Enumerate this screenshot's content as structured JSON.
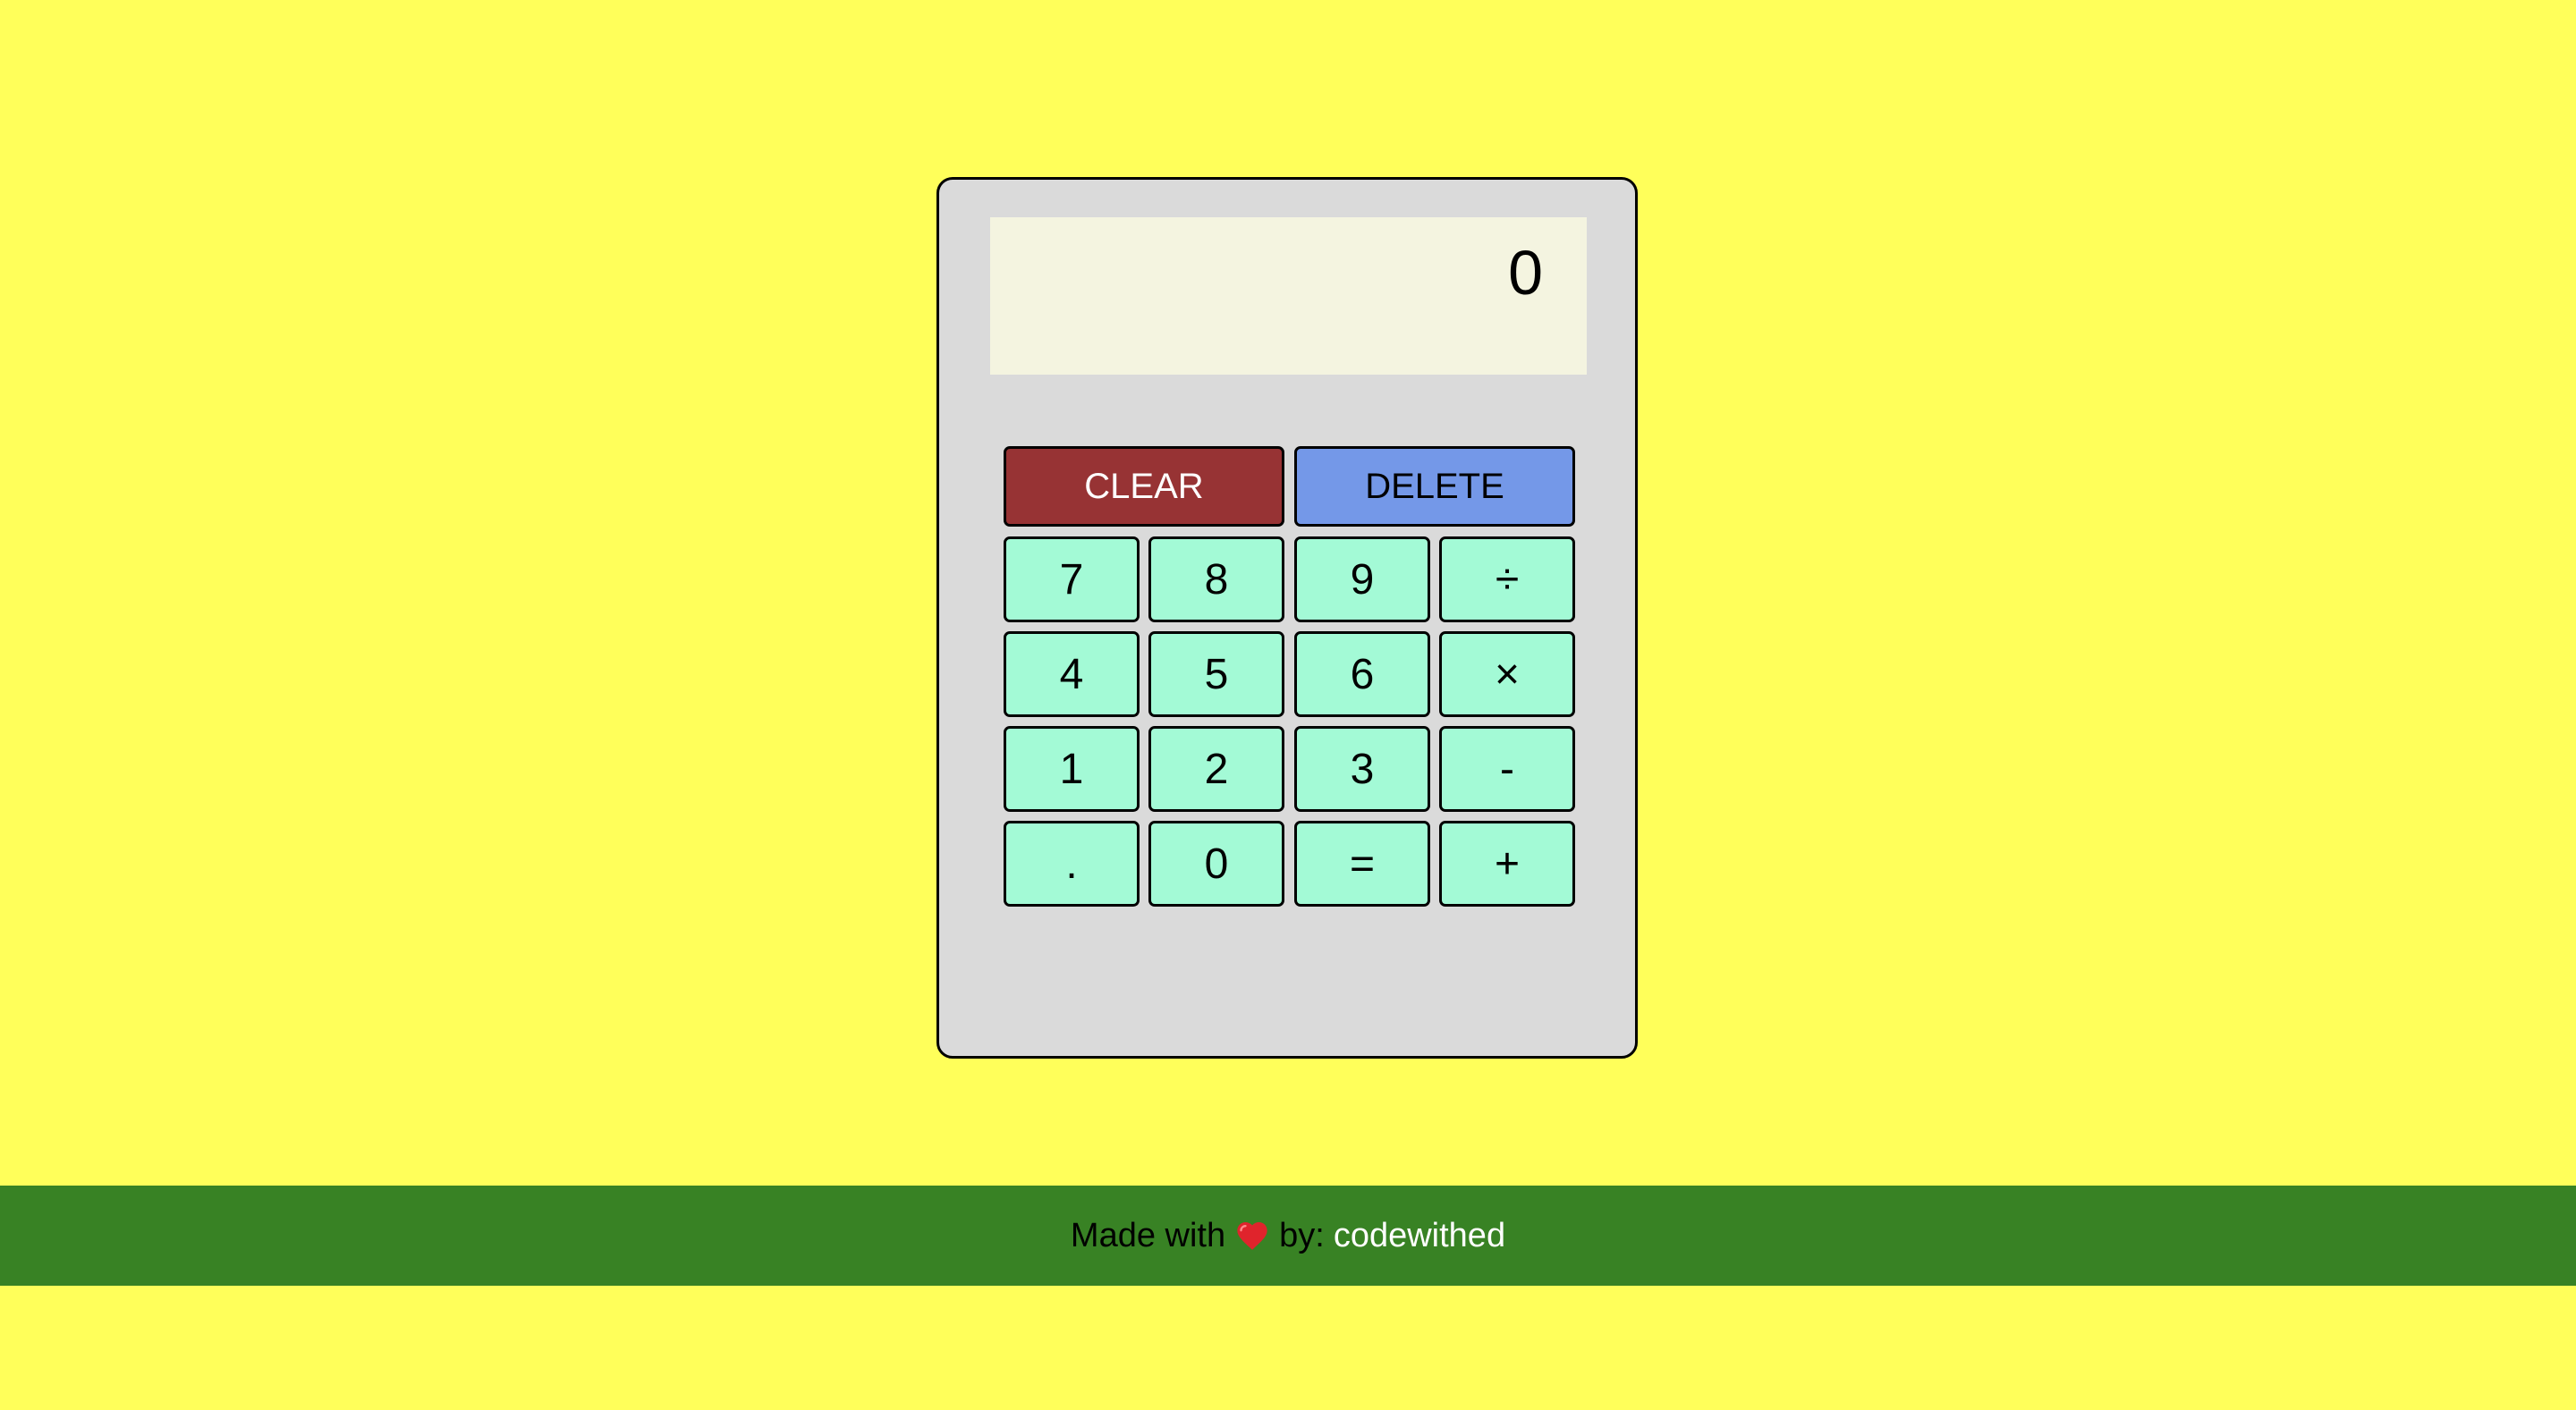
{
  "calculator": {
    "display_value": "0",
    "buttons": {
      "clear": "CLEAR",
      "delete": "DELETE",
      "rows": [
        [
          "7",
          "8",
          "9",
          "÷"
        ],
        [
          "4",
          "5",
          "6",
          "×"
        ],
        [
          "1",
          "2",
          "3",
          "-"
        ],
        [
          ".",
          "0",
          "=",
          "+"
        ]
      ]
    },
    "colors": {
      "page_background": "#ffff5a",
      "body": "#dadada",
      "display": "#f4f4e0",
      "clear_button": "#973334",
      "delete_button": "#7498e8",
      "key_button": "#a3fad6"
    }
  },
  "footer": {
    "prefix": "Made with",
    "icon": "heart-icon",
    "by_text": "by:",
    "author": "codewithed",
    "background": "#388224"
  }
}
